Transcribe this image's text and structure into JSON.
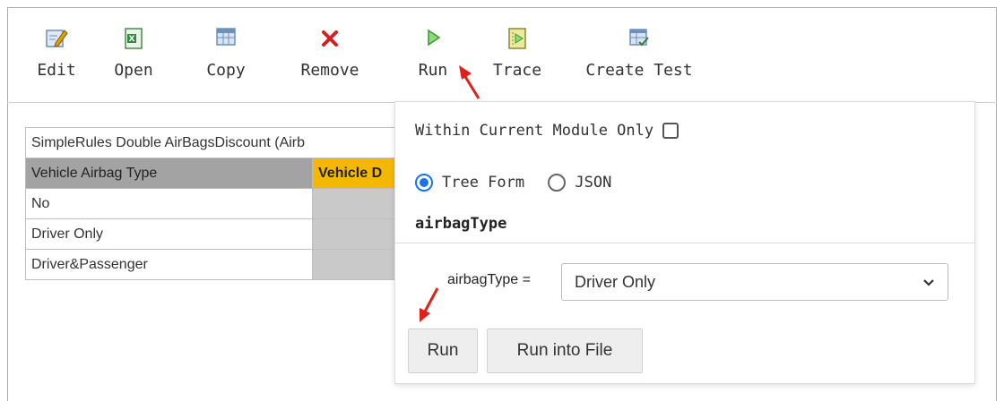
{
  "toolbar": {
    "items": [
      {
        "label": "Edit",
        "icon": "edit-icon"
      },
      {
        "label": "Open",
        "icon": "excel-icon"
      },
      {
        "label": "Copy",
        "icon": "copy-table-icon"
      },
      {
        "label": "Remove",
        "icon": "remove-x-icon"
      },
      {
        "label": "Run",
        "icon": "run-play-icon"
      },
      {
        "label": "Trace",
        "icon": "trace-icon"
      },
      {
        "label": "Create Test",
        "icon": "create-test-icon"
      }
    ]
  },
  "table": {
    "title": "SimpleRules Double AirBagsDiscount (Airb",
    "header1": "Vehicle Airbag Type",
    "header2": "Vehicle D",
    "rows": [
      "No",
      "Driver Only",
      "Driver&Passenger"
    ]
  },
  "popup": {
    "module_only_label": "Within Current Module Only",
    "tree_form_label": "Tree Form",
    "json_label": "JSON",
    "section_title": "airbagType",
    "param_label": "airbagType =",
    "param_value": "Driver Only",
    "run_button": "Run",
    "run_into_file_button": "Run into File"
  },
  "colors": {
    "accent_radio": "#1a73e8",
    "table_header_gray": "#a3a3a3",
    "table_header_orange": "#f5b800",
    "annotation_arrow": "#e0201b"
  }
}
